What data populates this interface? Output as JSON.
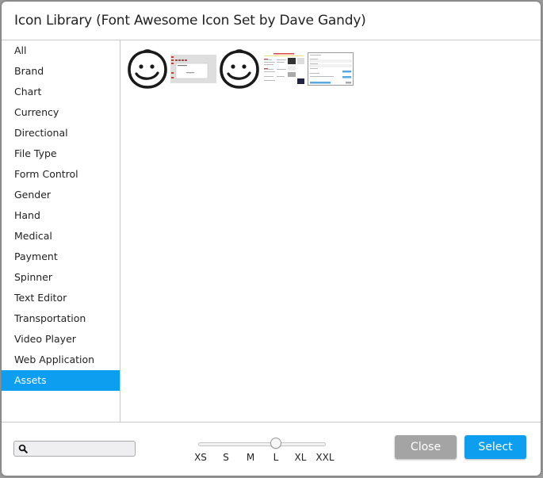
{
  "dialog": {
    "title": "Icon Library (Font Awesome Icon Set by Dave Gandy)"
  },
  "sidebar": {
    "items": [
      {
        "label": "All"
      },
      {
        "label": "Brand"
      },
      {
        "label": "Chart"
      },
      {
        "label": "Currency"
      },
      {
        "label": "Directional"
      },
      {
        "label": "File Type"
      },
      {
        "label": "Form Control"
      },
      {
        "label": "Gender"
      },
      {
        "label": "Hand"
      },
      {
        "label": "Medical"
      },
      {
        "label": "Payment"
      },
      {
        "label": "Spinner"
      },
      {
        "label": "Text Editor"
      },
      {
        "label": "Transportation"
      },
      {
        "label": "Video Player"
      },
      {
        "label": "Web Application"
      },
      {
        "label": "Assets",
        "active": true
      }
    ]
  },
  "assets": [
    {
      "type": "smiley-icon"
    },
    {
      "type": "screenshot-thumbnail-dialog"
    },
    {
      "type": "smiley-icon"
    },
    {
      "type": "screenshot-thumbnail-webpage"
    },
    {
      "type": "screenshot-thumbnail-form"
    }
  ],
  "search": {
    "value": "",
    "placeholder": ""
  },
  "size_slider": {
    "labels": [
      "XS",
      "S",
      "M",
      "L",
      "XL",
      "XXL"
    ],
    "selected": "L",
    "selected_index": 3
  },
  "buttons": {
    "close": "Close",
    "select": "Select"
  },
  "colors": {
    "accent": "#0e9ef0",
    "close_button": "#a4a4a4"
  }
}
